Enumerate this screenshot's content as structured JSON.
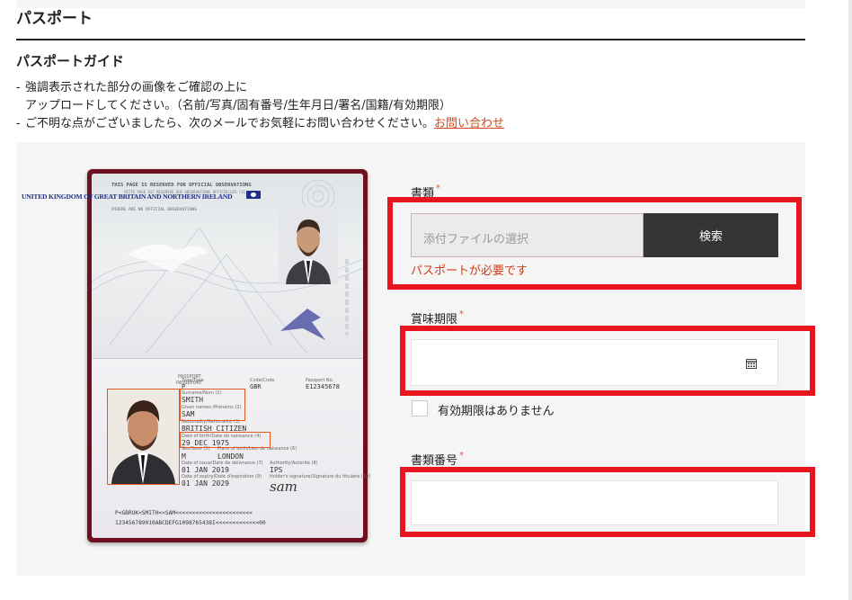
{
  "page": {
    "title": "パスポート",
    "guide_title": "パスポートガイド",
    "instructions": {
      "line1": "強調表示された部分の画像をご確認の上に",
      "line2": "アップロードしてください。（名前/写真/固有番号/生年月日/署名/国籍/有効期限）",
      "line3": "ご不明な点がございましたら、次のメールでお気軽にお問い合わせください。",
      "dash": "-",
      "inquiry_link": "お問い合わせ"
    }
  },
  "passport": {
    "reserved_line1": "THIS PAGE IS RESERVED FOR OFFICIAL OBSERVATIONS",
    "reserved_line2": "CETTE PAGE EST RESERVEE AUX OBSERVATIONS OFFICIELLES (11)",
    "reserved_line3": "OTHERE ARE NO OFFICIAL OBSERVATIONS",
    "country": "UNITED KINGDOM OF GREAT BRITAIN AND NORTHERN IRELAND",
    "doc_label": "PASSPORT",
    "doc_label_fr": "PASSEPORT",
    "type_label": "Type/Type",
    "type": "P",
    "code_label": "Code/Code",
    "code": "GBR",
    "number_label": "Passport No.",
    "number": "E12345678",
    "surname_label": "Surname/Nom (1)",
    "surname": "SMITH",
    "given_label": "Given names /Prénoms (2)",
    "given": "SAM",
    "nationality_label": "Nationality/Nationalité (3)",
    "nationality": "BRITISH CITIZEN",
    "dob_label": "Date of birth/Date de naissance (4)",
    "dob": "29 DEC 1975",
    "sex_label": "Sex/Sexe (5)",
    "sex": "M",
    "pob_label": "Place of birth/Lieu de naissance (6)",
    "pob": "LONDON",
    "issue_label": "Date of issue/Date de délivrance (7)",
    "issue": "01 JAN 2019",
    "authority_label": "Authority/Autorité (8)",
    "authority": "IPS",
    "expiry_label": "Date of expiry/Date d'expiration (9)",
    "expiry": "01 JAN 2029",
    "signature_label": "Holder's signature/Signature du titulaire (10)",
    "signature": "sam",
    "mrz1": "P<GBRUK<SMITH<<SAM<<<<<<<<<<<<<<<<<<<<<<<",
    "mrz2": "123456789010ABCDEFG1098765438I<<<<<<<<<<<<<00"
  },
  "form": {
    "doc_type_label": "書類",
    "required_mark": "*",
    "file_placeholder": "添付ファイルの選択",
    "browse_button": "検索",
    "error": "パスポートが必要です",
    "expiry_label": "賞味期限",
    "expiry_value": "",
    "calendar_icon": "calendar-icon",
    "no_expiry_label": "有効期限はありません",
    "no_expiry_checked": false,
    "doc_number_label": "書類番号",
    "doc_number_value": ""
  },
  "colors": {
    "highlight_border": "#e8151e",
    "link": "#d24a1c",
    "error": "#d23a10",
    "button_bg": "#353535",
    "passport_cover": "#6d1020"
  }
}
